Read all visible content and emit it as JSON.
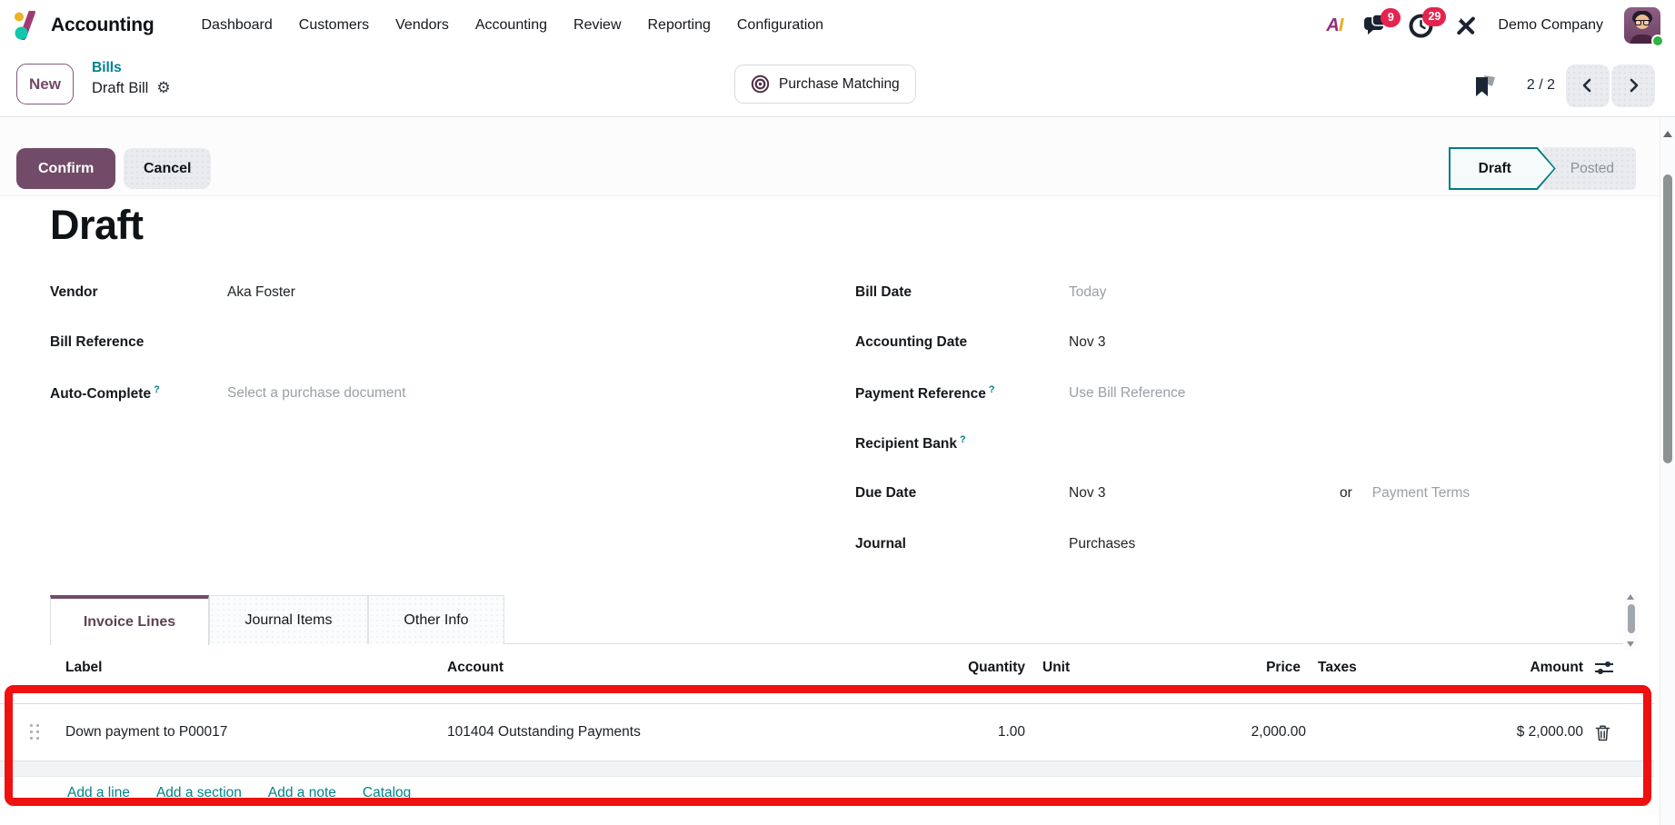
{
  "navbar": {
    "app_name": "Accounting",
    "menus": [
      "Dashboard",
      "Customers",
      "Vendors",
      "Accounting",
      "Review",
      "Reporting",
      "Configuration"
    ],
    "ai": {
      "a": "A",
      "i": "I"
    },
    "messages_badge": "9",
    "activities_badge": "29",
    "company": "Demo Company"
  },
  "breadcrumb": {
    "new_button": "New",
    "parent": "Bills",
    "current": "Draft Bill",
    "action": "Purchase Matching",
    "pager": "2 / 2"
  },
  "statusbar": {
    "confirm": "Confirm",
    "cancel": "Cancel",
    "draft": "Draft",
    "posted": "Posted"
  },
  "form": {
    "title": "Draft",
    "help_mark": "?",
    "vendor_label": "Vendor",
    "vendor_value": "Aka Foster",
    "bill_ref_label": "Bill Reference",
    "autocomplete_label": "Auto-Complete",
    "autocomplete_placeholder": "Select a purchase document",
    "bill_date_label": "Bill Date",
    "bill_date_placeholder": "Today",
    "accounting_date_label": "Accounting Date",
    "accounting_date_value": "Nov 3",
    "payment_ref_label": "Payment Reference",
    "payment_ref_placeholder": "Use Bill Reference",
    "recipient_bank_label": "Recipient Bank",
    "due_date_label": "Due Date",
    "due_date_value": "Nov 3",
    "or_label": "or",
    "payment_terms_placeholder": "Payment Terms",
    "journal_label": "Journal",
    "journal_value": "Purchases"
  },
  "tabs": {
    "invoice_lines": "Invoice Lines",
    "journal_items": "Journal Items",
    "other_info": "Other Info"
  },
  "table": {
    "headers": {
      "label": "Label",
      "account": "Account",
      "quantity": "Quantity",
      "unit": "Unit",
      "price": "Price",
      "taxes": "Taxes",
      "amount": "Amount"
    },
    "row": {
      "label": "Down payment to P00017",
      "account": "101404 Outstanding Payments",
      "quantity": "1.00",
      "price": "2,000.00",
      "amount": "$ 2,000.00"
    },
    "links": {
      "add_line": "Add a line",
      "add_section": "Add a section",
      "add_note": "Add a note",
      "catalog": "Catalog"
    }
  },
  "icons": {
    "gear": "⚙"
  },
  "colors": {
    "primary": "#714B67",
    "teal_link": "#01838a",
    "badge": "#e5244e",
    "stage_border": "#027c83",
    "annotation": "#ef1010"
  }
}
